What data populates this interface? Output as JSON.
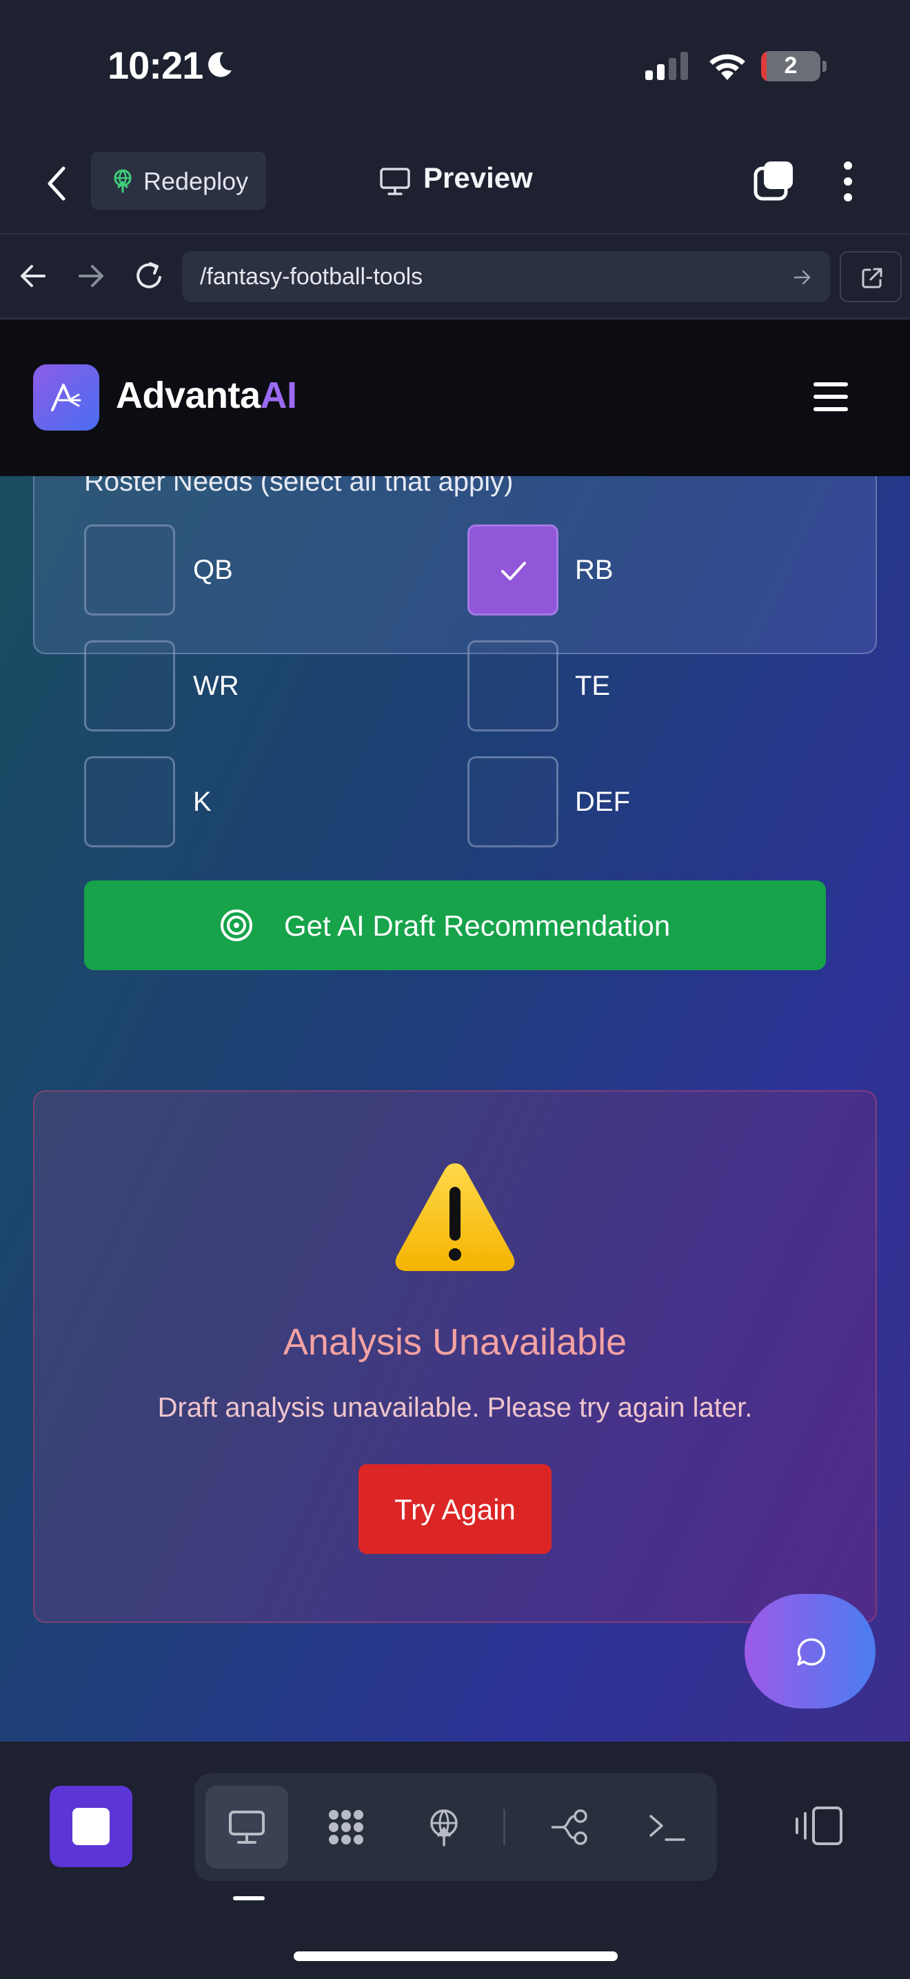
{
  "status_bar": {
    "time": "10:21",
    "battery_level": "2",
    "icons": [
      "moon-icon",
      "signal-icon",
      "wifi-icon",
      "battery-icon"
    ]
  },
  "app_header": {
    "redeploy_label": "Redeploy",
    "preview_label": "Preview",
    "icons": [
      "back-chevron-icon",
      "redeploy-icon",
      "monitor-icon",
      "tabs-icon",
      "kebab-menu-icon"
    ]
  },
  "browser": {
    "url": "/fantasy-football-tools",
    "icons": [
      "arrow-left-icon",
      "arrow-right-icon",
      "reload-icon",
      "go-arrow-icon",
      "external-link-icon"
    ]
  },
  "site": {
    "brand_prefix": "Advanta",
    "brand_suffix": "AI",
    "colors": {
      "brand_accent": "#9b6bf2",
      "primary_button": "#16a34a",
      "danger_button": "#dc2626",
      "checked": "#9256d9"
    },
    "roster": {
      "heading": "Roster Needs (select all that apply)",
      "options": [
        {
          "label": "QB",
          "checked": false
        },
        {
          "label": "RB",
          "checked": true
        },
        {
          "label": "WR",
          "checked": false
        },
        {
          "label": "TE",
          "checked": false
        },
        {
          "label": "K",
          "checked": false
        },
        {
          "label": "DEF",
          "checked": false
        }
      ]
    },
    "draft_button_label": "Get AI Draft Recommendation",
    "error": {
      "icon": "warning-icon",
      "title": "Analysis Unavailable",
      "message": "Draft analysis unavailable. Please try again later.",
      "retry_label": "Try Again"
    },
    "chat_icon": "chat-bubble-icon"
  },
  "bottom_toolbar": {
    "active_tool": "preview",
    "tools": [
      "stop-icon",
      "monitor-icon",
      "apps-grid-icon",
      "deploy-icon",
      "git-branch-icon",
      "terminal-icon",
      "panel-icon"
    ]
  }
}
